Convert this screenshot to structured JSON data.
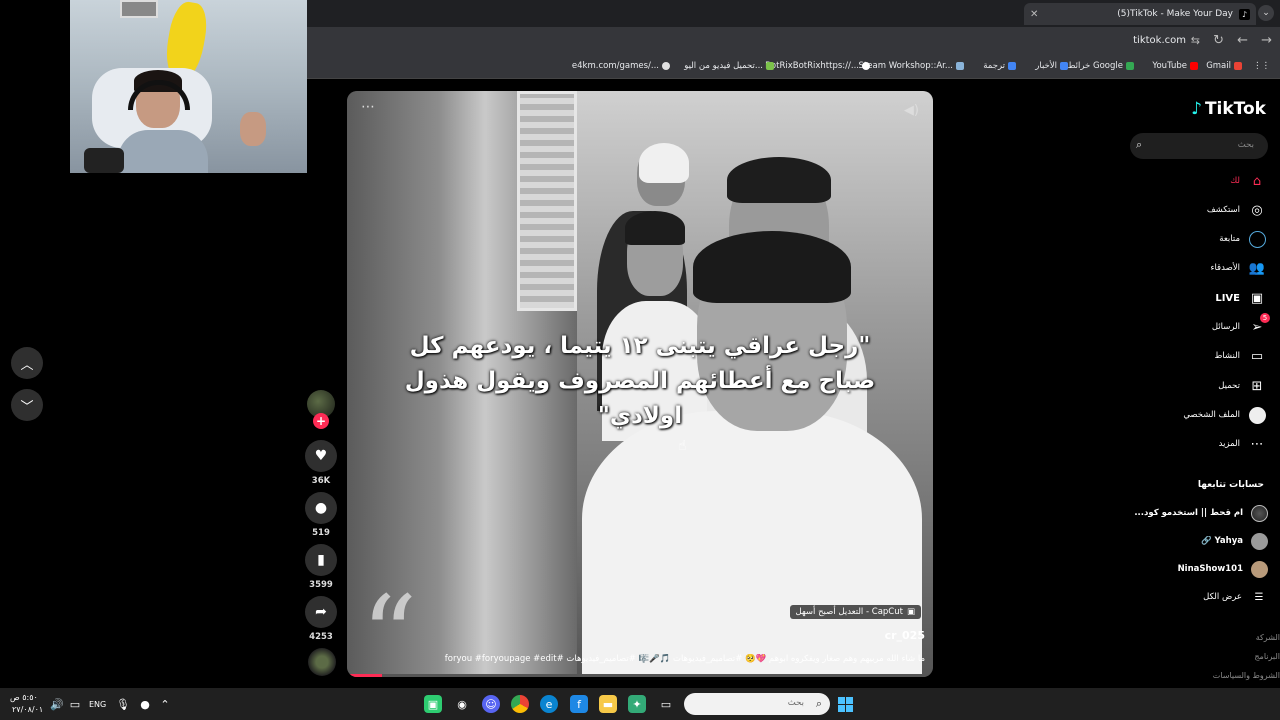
{
  "browser": {
    "tab_title": "(5)TikTok - Make Your Day",
    "tab_close": "✕",
    "new_tab": "+",
    "url": "tiktok.com",
    "bookmarks": [
      "Gmail",
      "YouTube",
      "خرائط Google",
      "الأخبار",
      "ترجمة",
      "Steam Workshop::Ar...",
      "BotRixBotRixhttps://...",
      "تحميل فيديو من اليو...",
      "e4km.com/games/..."
    ]
  },
  "video": {
    "caption": "\"رجل عراقي يتبنى ١٢ يتيما ، يودعهم كل صباح مع أعطائهم المصروف ويقول هذول اولادي\"",
    "quote_mark": "“",
    "capcut_label": "CapCut - التعديل أصبح أسهل",
    "author": "cr_025",
    "description": "ما شاء الله مربيهم وهم صغار ويفكروه ابوهم 💖🥺 #تصاميم_فيديوهات 🎵🎤🎼 #تصاميم_فيديوهات #foryou #foryoupage #edit",
    "progress": 0.06
  },
  "actions": {
    "like_count": "36K",
    "comment_count": "519",
    "save_count": "3599",
    "share_count": "4253"
  },
  "sidebar": {
    "logo": "TikTok",
    "search_placeholder": "بحث",
    "menu": [
      {
        "label": "لك",
        "icon": "home-icon"
      },
      {
        "label": "استكشف",
        "icon": "compass-icon"
      },
      {
        "label": "متابعة",
        "icon": "following-icon"
      },
      {
        "label": "الأصدقاء",
        "icon": "friends-icon"
      },
      {
        "label": "LIVE",
        "icon": "live-icon"
      },
      {
        "label": "الرسائل",
        "icon": "messages-icon",
        "badge": "5"
      },
      {
        "label": "النشاط",
        "icon": "activity-icon"
      },
      {
        "label": "تحميل",
        "icon": "upload-icon"
      },
      {
        "label": "الملف الشخصي",
        "icon": "profile-icon"
      },
      {
        "label": "المزيد",
        "icon": "more-icon"
      }
    ],
    "following_title": "حسابات تتابعها",
    "accounts": [
      "ام قحط || استخدمو كود...",
      "Yahya 🔗",
      "NinaShow101"
    ],
    "see_all": "عرض الكل",
    "footer": [
      "الشركة",
      "البرنامج",
      "الشروط والسياسات"
    ]
  },
  "taskbar": {
    "search_placeholder": "بحث",
    "language": "ENG",
    "time": "٥:٥٠ ص",
    "date": "٢٧/٠٨/٠١"
  },
  "colors": {
    "accent": "#fe2c55",
    "chrome_dark": "#1f2023",
    "chrome": "#35363a"
  }
}
